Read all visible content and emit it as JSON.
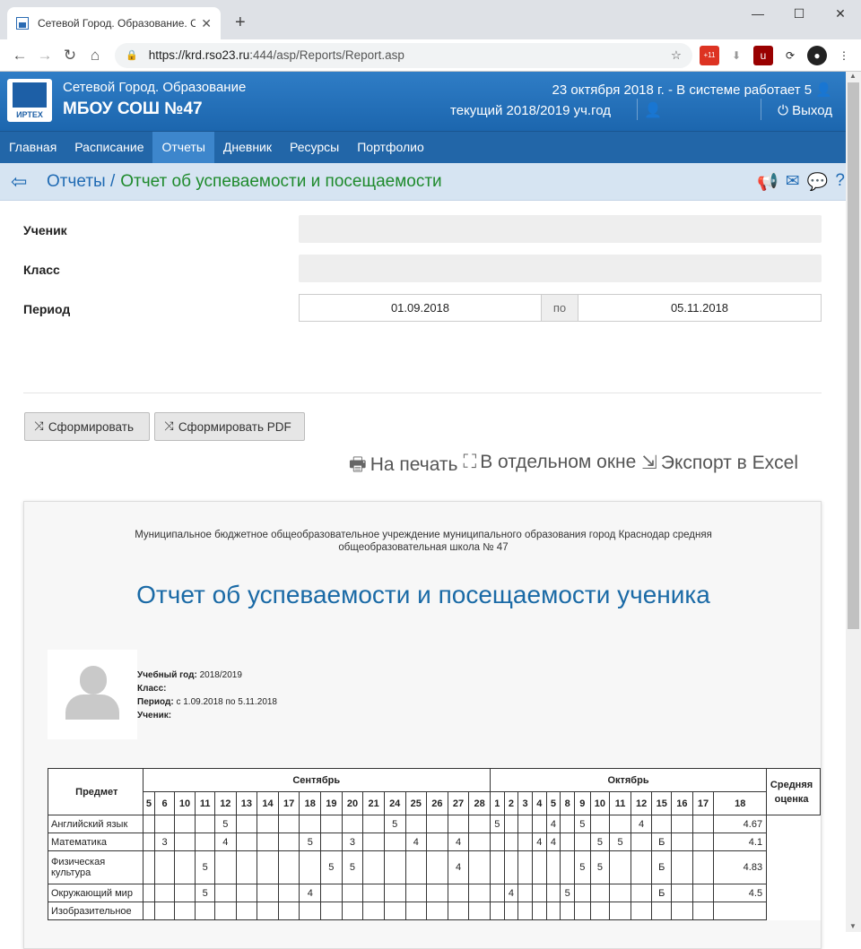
{
  "browser": {
    "tab_title": "Сетевой Город. Образование. С",
    "url_host": "https://krd.rso23.ru",
    "url_rest": ":444/asp/Reports/Report.asp",
    "badge": "+11"
  },
  "app": {
    "logo_text": "ИРТЕХ",
    "system_name": "Сетевой Город. Образование",
    "school": "МБОУ СОШ №47",
    "date_line": "23 октября 2018 г. - В системе работает 5",
    "year_line": "текущий 2018/2019 уч.год",
    "exit": "Выход"
  },
  "menu": [
    "Главная",
    "Расписание",
    "Отчеты",
    "Дневник",
    "Ресурсы",
    "Портфолио"
  ],
  "breadcrumb": {
    "parent": "Отчеты /",
    "current": "Отчет об успеваемости и посещаемости"
  },
  "form": {
    "student_label": "Ученик",
    "class_label": "Класс",
    "period_label": "Период",
    "date_from": "01.09.2018",
    "po": "по",
    "date_to": "05.11.2018",
    "btn_generate": "Сформировать",
    "btn_pdf": "Сформировать PDF",
    "print": "На печать",
    "window": "В отдельном окне",
    "excel": "Экспорт в Excel"
  },
  "report": {
    "org": "Муниципальное бюджетное общеобразовательное учреждение муниципального образования город Краснодар средняя общеобразовательная школа № 47",
    "title": "Отчет об успеваемости и посещаемости ученика",
    "year_label": "Учебный год:",
    "year_value": "2018/2019",
    "class_label": "Класс:",
    "period_label": "Период:",
    "period_value": "с 1.09.2018 по 5.11.2018",
    "student_label": "Ученик:"
  },
  "grid": {
    "subject_header": "Предмет",
    "avg_header": "Средняя оценка",
    "months": [
      {
        "name": "Сентябрь",
        "days": [
          "5",
          "6",
          "10",
          "11",
          "12",
          "13",
          "14",
          "17",
          "18",
          "19",
          "20",
          "21",
          "24",
          "25",
          "26",
          "27",
          "28"
        ]
      },
      {
        "name": "Октябрь",
        "days": [
          "1",
          "2",
          "3",
          "4",
          "5",
          "8",
          "9",
          "10",
          "11",
          "12",
          "15",
          "16",
          "17",
          "18"
        ]
      }
    ],
    "rows": [
      {
        "subject": "Английский язык",
        "marks": [
          "",
          "",
          "",
          "",
          "5",
          "",
          "",
          "",
          "",
          "",
          "",
          "",
          "5",
          "",
          "",
          "",
          "",
          "5",
          "",
          "",
          "",
          "4",
          "",
          "5",
          "",
          "",
          "4",
          "",
          "",
          ""
        ],
        "avg": "4.67"
      },
      {
        "subject": "Математика",
        "marks": [
          "",
          "3",
          "",
          "",
          "4",
          "",
          "",
          "",
          "5",
          "",
          "3",
          "",
          "",
          "4",
          "",
          "4",
          "",
          "",
          "",
          "",
          "4",
          "4",
          "",
          "",
          "5",
          "5",
          "",
          "Б",
          "",
          ""
        ],
        "avg": "4.1"
      },
      {
        "subject": "Физическая культура",
        "marks": [
          "",
          "",
          "",
          "5",
          "",
          "",
          "",
          "",
          "",
          "5",
          "5",
          "",
          "",
          "",
          "",
          "4",
          "",
          "",
          "",
          "",
          "",
          "",
          "",
          "5",
          "5",
          "",
          "",
          "Б",
          "",
          ""
        ],
        "avg": "4.83"
      },
      {
        "subject": "Окружающий мир",
        "marks": [
          "",
          "",
          "",
          "5",
          "",
          "",
          "",
          "",
          "4",
          "",
          "",
          "",
          "",
          "",
          "",
          "",
          "",
          "",
          "4",
          "",
          "",
          "",
          "5",
          "",
          "",
          "",
          "",
          "Б",
          "",
          ""
        ],
        "avg": "4.5"
      },
      {
        "subject": "Изобразительное",
        "marks": [
          "",
          "",
          "",
          "",
          "",
          "",
          "",
          "",
          "",
          "",
          "",
          "",
          "",
          "",
          "",
          "",
          "",
          "",
          "",
          "",
          "",
          "",
          "",
          "",
          "",
          "",
          "",
          "",
          "",
          ""
        ],
        "avg": ""
      }
    ]
  }
}
